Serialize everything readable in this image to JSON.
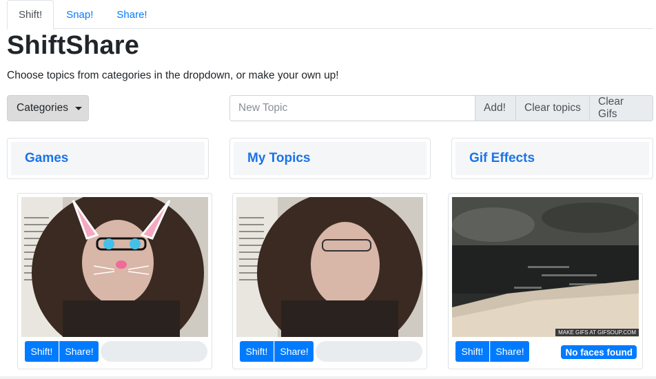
{
  "tabs": [
    {
      "label": "Shift!",
      "active": true
    },
    {
      "label": "Snap!",
      "active": false
    },
    {
      "label": "Share!",
      "active": false
    }
  ],
  "header": {
    "title": "ShiftShare",
    "subtitle": "Choose topics from categories in the dropdown, or make your own up!"
  },
  "controls": {
    "dropdown_label": "Categories",
    "topic_placeholder": "New Topic",
    "add_label": "Add!",
    "clear_topics_label": "Clear topics",
    "clear_gifs_label": "Clear Gifs"
  },
  "categories": [
    {
      "label": "Games"
    },
    {
      "label": "My Topics"
    },
    {
      "label": "Gif Effects"
    }
  ],
  "gifs": [
    {
      "shift_label": "Shift!",
      "share_label": "Share!",
      "image": "webcam-cat-filter"
    },
    {
      "shift_label": "Shift!",
      "share_label": "Share!",
      "image": "webcam-plain"
    },
    {
      "shift_label": "Shift!",
      "share_label": "Share!",
      "image": "river-gif",
      "status": "No faces found",
      "watermark": "MAKE GIFS AT GIFSOUP.COM"
    }
  ],
  "colors": {
    "primary": "#007bff",
    "link": "#1a73e8",
    "muted_bg": "#e9ecef"
  }
}
